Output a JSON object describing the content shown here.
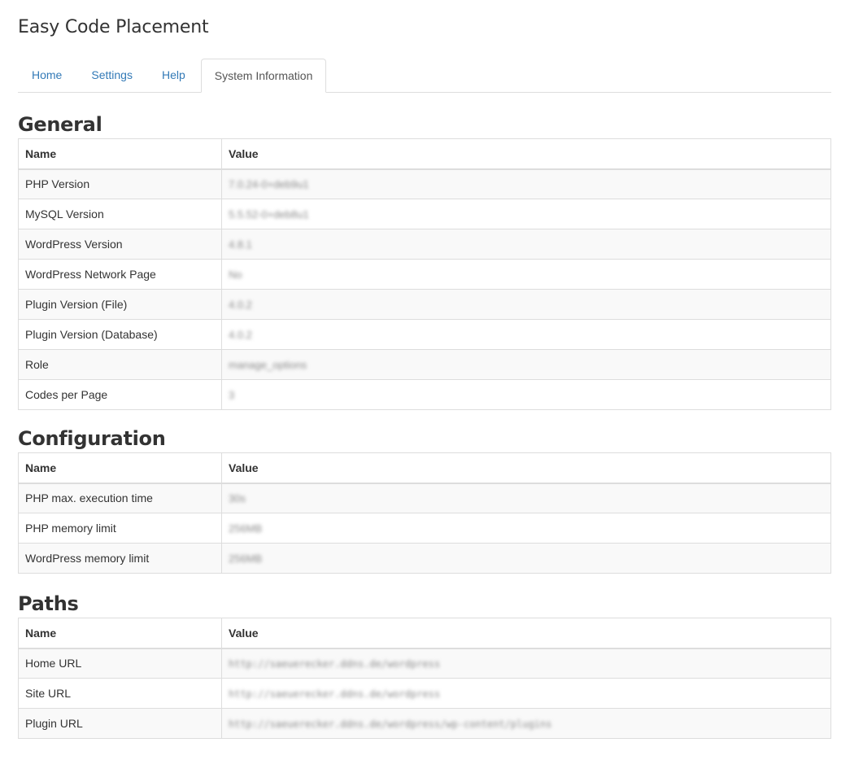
{
  "app": {
    "title": "Easy Code Placement"
  },
  "tabs": [
    {
      "label": "Home",
      "active": false
    },
    {
      "label": "Settings",
      "active": false
    },
    {
      "label": "Help",
      "active": false
    },
    {
      "label": "System Information",
      "active": true
    }
  ],
  "columns": {
    "name": "Name",
    "value": "Value"
  },
  "sections": {
    "general": {
      "title": "General",
      "rows": [
        {
          "name": "PHP Version",
          "value": "7.0.24-0+deb9u1"
        },
        {
          "name": "MySQL Version",
          "value": "5.5.52-0+deb8u1"
        },
        {
          "name": "WordPress Version",
          "value": "4.8.1"
        },
        {
          "name": "WordPress Network Page",
          "value": "No"
        },
        {
          "name": "Plugin Version (File)",
          "value": "4.0.2"
        },
        {
          "name": "Plugin Version (Database)",
          "value": "4.0.2"
        },
        {
          "name": "Role",
          "value": "manage_options"
        },
        {
          "name": "Codes per Page",
          "value": "3"
        }
      ]
    },
    "configuration": {
      "title": "Configuration",
      "rows": [
        {
          "name": "PHP max. execution time",
          "value": "30s"
        },
        {
          "name": "PHP memory limit",
          "value": "256MB"
        },
        {
          "name": "WordPress memory limit",
          "value": "256MB"
        }
      ]
    },
    "paths": {
      "title": "Paths",
      "rows": [
        {
          "name": "Home URL",
          "value": "http://saeuerecker.ddns.de/wordpress"
        },
        {
          "name": "Site URL",
          "value": "http://saeuerecker.ddns.de/wordpress"
        },
        {
          "name": "Plugin URL",
          "value": "http://saeuerecker.ddns.de/wordpress/wp-content/plugins"
        }
      ]
    }
  }
}
